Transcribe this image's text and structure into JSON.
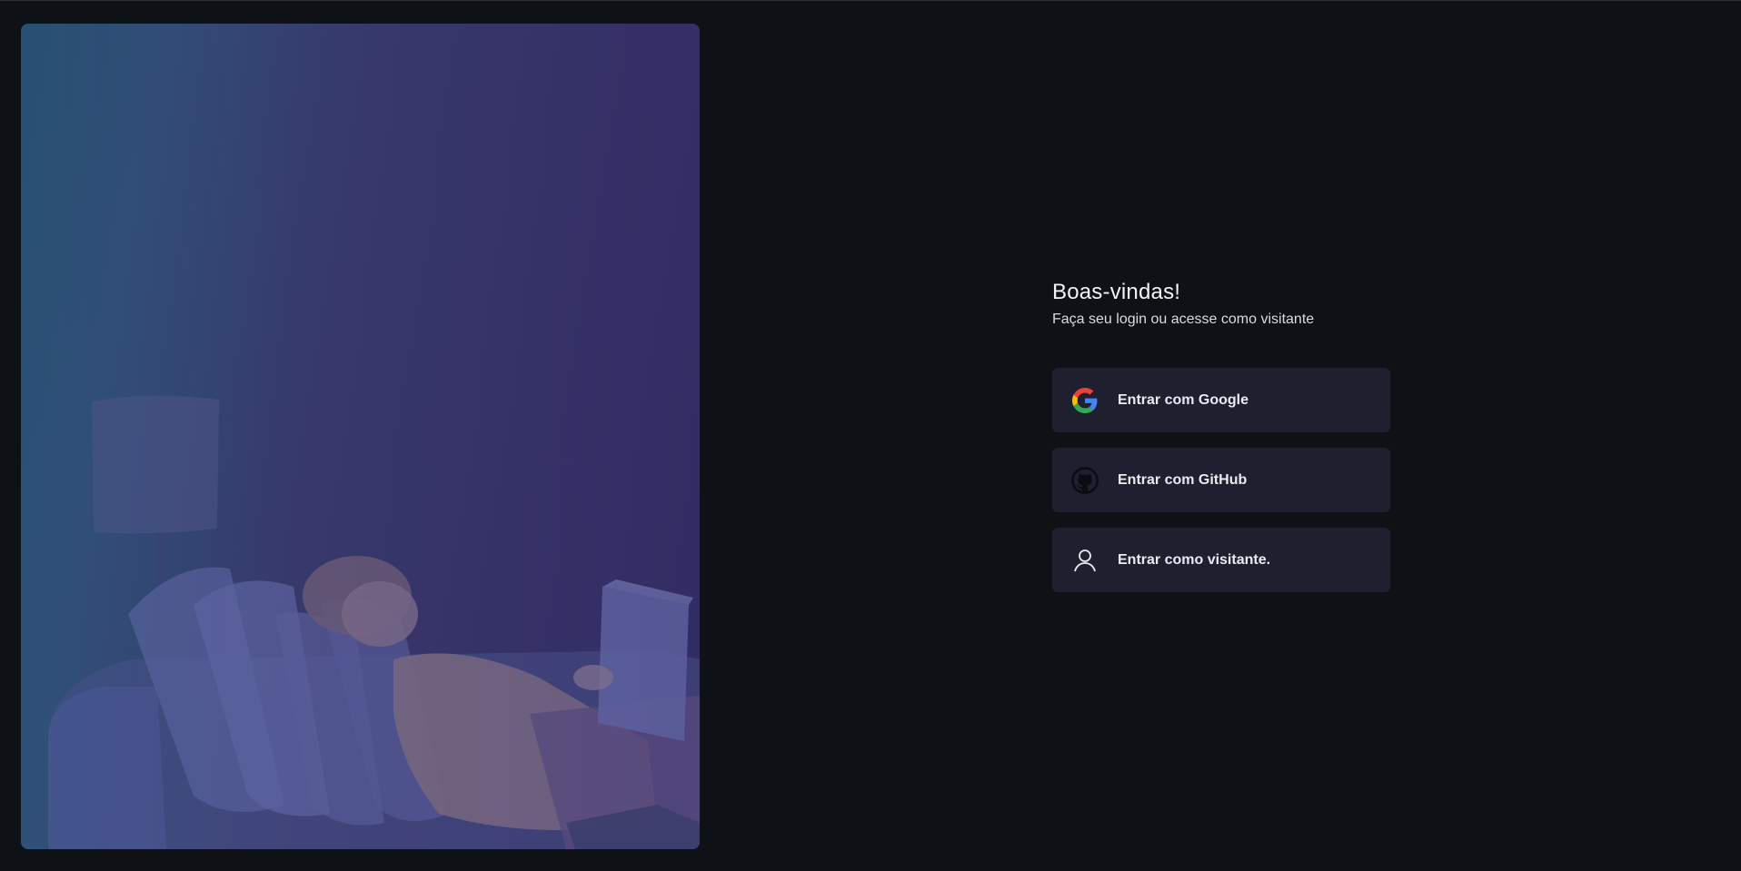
{
  "login": {
    "title": "Boas-vindas!",
    "subtitle": "Faça seu login ou acesse como visitante",
    "providers": [
      {
        "label": "Entrar com Google",
        "icon": "google-icon"
      },
      {
        "label": "Entrar com GitHub",
        "icon": "github-icon"
      },
      {
        "label": "Entrar como visitante.",
        "icon": "user-icon"
      }
    ]
  },
  "hero": {
    "alt": "Pessoa lendo um livro deitada no sofá",
    "tint_color": "#37386a"
  },
  "colors": {
    "background": "#0e1116",
    "button_background": "#1e2030",
    "text": "#e9ebf1"
  }
}
